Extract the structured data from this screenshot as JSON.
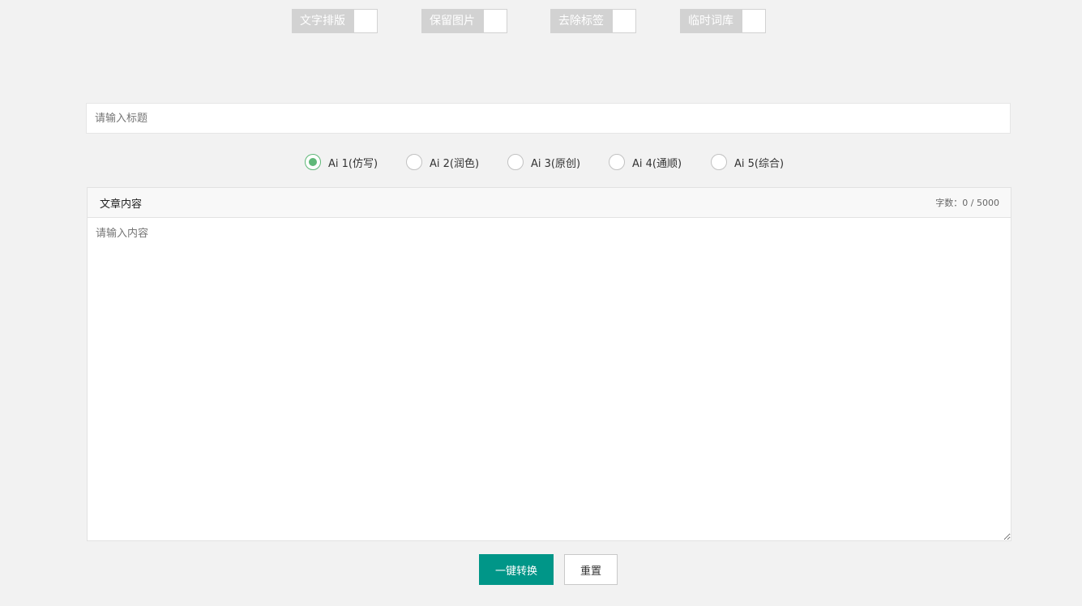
{
  "toggles": [
    {
      "label": "文字排版",
      "on": false
    },
    {
      "label": "保留图片",
      "on": false
    },
    {
      "label": "去除标签",
      "on": false
    },
    {
      "label": "临时词库",
      "on": false
    }
  ],
  "title_input": {
    "placeholder": "请输入标题",
    "value": ""
  },
  "ai_modes": [
    {
      "label": "Ai 1(仿写)",
      "checked": true
    },
    {
      "label": "Ai 2(润色)",
      "checked": false
    },
    {
      "label": "Ai 3(原创)",
      "checked": false
    },
    {
      "label": "Ai 4(通顺)",
      "checked": false
    },
    {
      "label": "Ai 5(综合)",
      "checked": false
    }
  ],
  "content": {
    "title": "文章内容",
    "counter": "字数：0 / 5000",
    "placeholder": "请输入内容",
    "value": ""
  },
  "actions": {
    "convert_label": "一键转换",
    "reset_label": "重置"
  },
  "colors": {
    "accent": "#5FB878",
    "primary_button": "#009688",
    "toggle_off": "#d2d2d2"
  }
}
